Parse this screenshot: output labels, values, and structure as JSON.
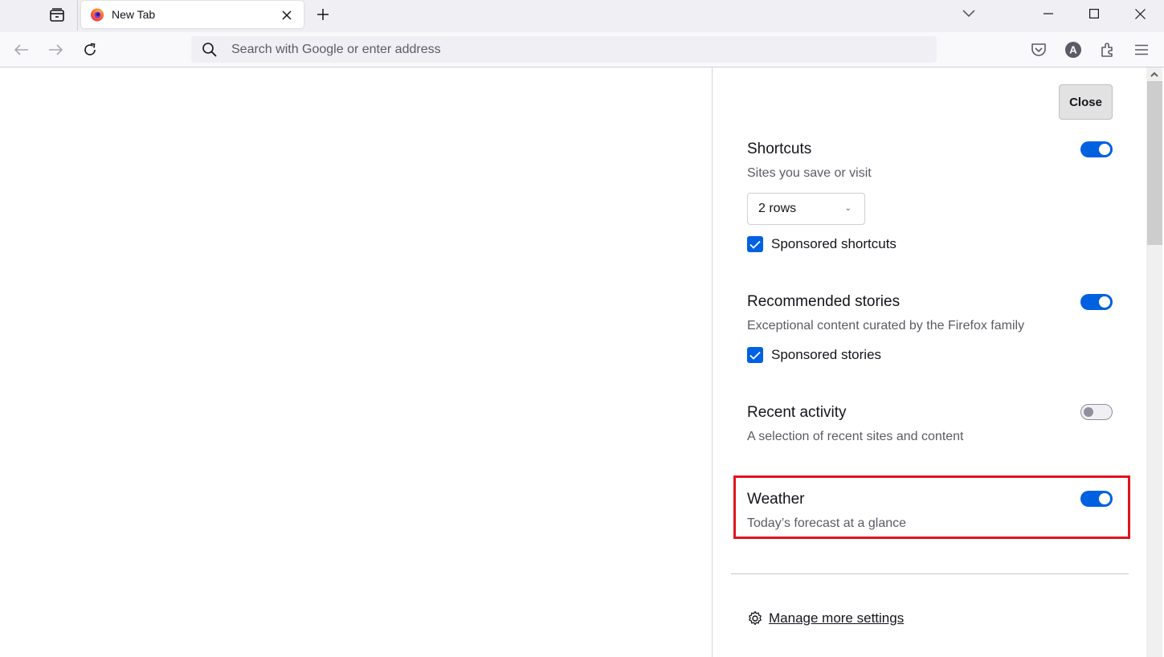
{
  "browser": {
    "tab": {
      "title": "New Tab"
    },
    "urlbar": {
      "placeholder": "Search with Google or enter address"
    }
  },
  "icons": {
    "tab_list": "folder-tab-icon",
    "favicon": "firefox-logo-icon",
    "tab_close": "close-icon",
    "new_tab": "plus-icon",
    "list_all_tabs": "chevron-down-icon",
    "minimize": "minimize-icon",
    "maximize": "maximize-icon",
    "close_window": "close-icon",
    "back": "arrow-left-icon",
    "forward": "arrow-right-icon",
    "reload": "reload-icon",
    "search": "search-icon",
    "pocket": "pocket-icon",
    "account": "account-avatar-icon",
    "extensions": "puzzle-icon",
    "menu": "hamburger-menu-icon",
    "settings": "gear-icon"
  },
  "account": {
    "initial": "A"
  },
  "panel": {
    "close_label": "Close",
    "sections": [
      {
        "title": "Shortcuts",
        "description": "Sites you save or visit",
        "enabled": true,
        "rows_select": {
          "value": "2 rows"
        },
        "checkbox": {
          "label": "Sponsored shortcuts",
          "checked": true
        }
      },
      {
        "title": "Recommended stories",
        "description": "Exceptional content curated by the Firefox family",
        "enabled": true,
        "checkbox": {
          "label": "Sponsored stories",
          "checked": true
        }
      },
      {
        "title": "Recent activity",
        "description": "A selection of recent sites and content",
        "enabled": false
      },
      {
        "title": "Weather",
        "description": "Today’s forecast at a glance",
        "enabled": true,
        "highlighted": true
      }
    ],
    "manage_link": "Manage more settings"
  },
  "colors": {
    "accent": "#0061e0",
    "highlight_border": "#e0141e"
  }
}
